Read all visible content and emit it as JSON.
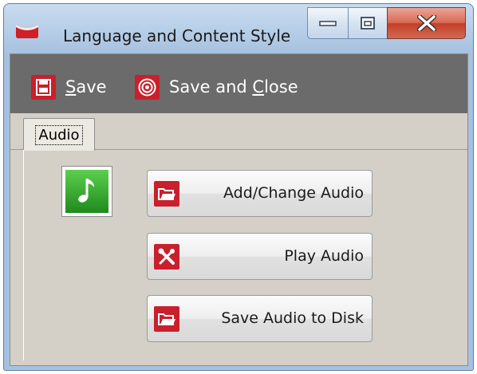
{
  "window": {
    "title": "Language and Content Style"
  },
  "toolbar": {
    "save_label": "Save",
    "save_mnemonic": "S",
    "save_close_label": "Save and Close",
    "save_close_prefix": "Save and ",
    "save_close_mnemonic": "C",
    "save_close_rest": "lose"
  },
  "tabs": [
    {
      "label": "Audio",
      "selected": true
    }
  ],
  "actions": {
    "add_change_audio": {
      "label": "Add/Change Audio",
      "icon": "folder-open-icon"
    },
    "play_audio": {
      "label": "Play Audio",
      "icon": "tools-icon"
    },
    "save_audio_to_disk": {
      "label": "Save Audio to Disk",
      "icon": "folder-open-icon"
    }
  },
  "audio_icon": "music-note-icon",
  "colors": {
    "toolbar_bg": "#6b6b6b",
    "accent_red": "#c8202c",
    "audio_green": "#2e9f2a",
    "panel_bg": "#d4d0c8",
    "close_red": "#c2402a"
  }
}
